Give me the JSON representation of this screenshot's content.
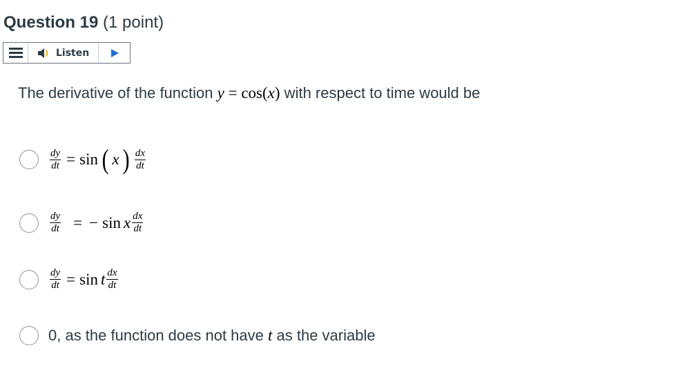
{
  "question": {
    "title": "Question 19",
    "points": "(1 point)"
  },
  "listen_toolbar": {
    "menu_icon": "hamburger-menu-icon",
    "speaker_icon": "speaker-icon",
    "listen_label": "Listen",
    "play_icon": "play-icon",
    "play_color": "#2d8a4e"
  },
  "prompt": {
    "text_before": "The derivative of the function ",
    "math_y": "y",
    "math_eq": " = ",
    "math_cos": "cos",
    "math_paren_open": "(",
    "math_x": "x",
    "math_paren_close": ")",
    "text_after": " with respect to time would be"
  },
  "options": [
    {
      "lhs_num": "dy",
      "lhs_den": "dt",
      "relation": "=",
      "fn": "sin",
      "paren_open": "(",
      "arg": "x",
      "paren_close": ")",
      "rhs_num": "dx",
      "rhs_den": "dt"
    },
    {
      "lhs_num": "dy",
      "lhs_den": "dt",
      "relation": "=",
      "sign": "−",
      "fn": "sin",
      "arg": "x",
      "rhs_num": "dx",
      "rhs_den": "dt"
    },
    {
      "lhs_num": "dy",
      "lhs_den": "dt",
      "relation": "=",
      "fn": "sin",
      "arg": "t",
      "rhs_num": "dx",
      "rhs_den": "dt"
    },
    {
      "text_before": "0, as the function does not have ",
      "var": "t",
      "text_after": " as the variable"
    }
  ]
}
